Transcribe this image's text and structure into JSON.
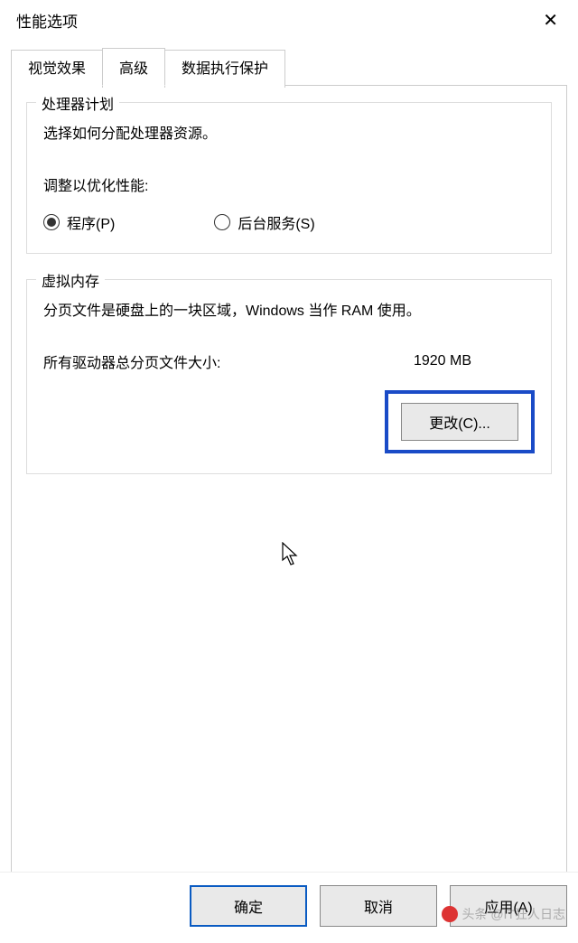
{
  "window": {
    "title": "性能选项"
  },
  "tabs": {
    "visual": "视觉效果",
    "advanced": "高级",
    "dep": "数据执行保护"
  },
  "processor": {
    "group_title": "处理器计划",
    "desc": "选择如何分配处理器资源。",
    "adjust_label": "调整以优化性能:",
    "option_programs": "程序(P)",
    "option_background": "后台服务(S)"
  },
  "vmem": {
    "group_title": "虚拟内存",
    "desc": "分页文件是硬盘上的一块区域，Windows 当作 RAM 使用。",
    "total_label": "所有驱动器总分页文件大小:",
    "total_value": "1920 MB",
    "change_button": "更改(C)..."
  },
  "buttons": {
    "ok": "确定",
    "cancel": "取消",
    "apply": "应用(A)"
  },
  "watermark": "头条 @IT狂人日志"
}
